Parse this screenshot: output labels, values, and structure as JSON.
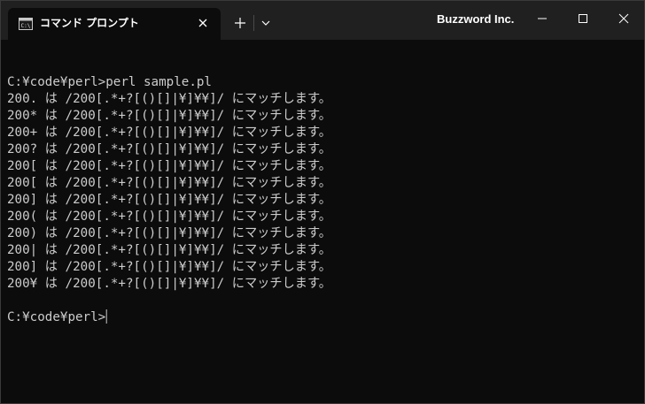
{
  "tab": {
    "title": "コマンド プロンプト",
    "icon": "cmd-icon"
  },
  "titlebar": {
    "brand": "Buzzword Inc."
  },
  "terminal": {
    "lines": [
      "",
      "C:¥code¥perl>perl sample.pl",
      "200. は /200[.*+?[()[]|¥]¥¥]/ にマッチします。",
      "200* は /200[.*+?[()[]|¥]¥¥]/ にマッチします。",
      "200+ は /200[.*+?[()[]|¥]¥¥]/ にマッチします。",
      "200? は /200[.*+?[()[]|¥]¥¥]/ にマッチします。",
      "200[ は /200[.*+?[()[]|¥]¥¥]/ にマッチします。",
      "200[ は /200[.*+?[()[]|¥]¥¥]/ にマッチします。",
      "200] は /200[.*+?[()[]|¥]¥¥]/ にマッチします。",
      "200( は /200[.*+?[()[]|¥]¥¥]/ にマッチします。",
      "200) は /200[.*+?[()[]|¥]¥¥]/ にマッチします。",
      "200| は /200[.*+?[()[]|¥]¥¥]/ にマッチします。",
      "200] は /200[.*+?[()[]|¥]¥¥]/ にマッチします。",
      "200¥ は /200[.*+?[()[]|¥]¥¥]/ にマッチします。",
      ""
    ],
    "prompt": "C:¥code¥perl>"
  },
  "colors": {
    "background": "#0c0c0c",
    "titlebar": "#202020",
    "text": "#cccccc"
  }
}
